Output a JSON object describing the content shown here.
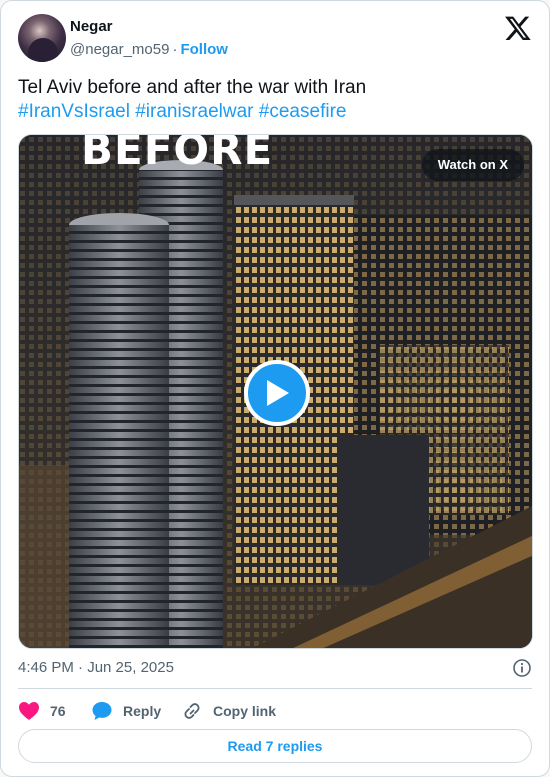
{
  "author": {
    "name": "Negar",
    "handle": "@negar_mo59",
    "separator": "·",
    "follow_label": "Follow"
  },
  "tweet": {
    "text": "Tel Aviv before and after the war with Iran",
    "hashtags": [
      "#IranVsIsrael",
      "#iranisraelwar",
      "#ceasefire"
    ]
  },
  "media": {
    "overlay_text": "BEFORE",
    "watch_label": "Watch on X",
    "play_icon": "play-icon"
  },
  "meta": {
    "timestamp": "4:46 PM · Jun 25, 2025",
    "info_icon": "info-icon"
  },
  "actions": {
    "likes_count": "76",
    "reply_label": "Reply",
    "copy_link_label": "Copy link"
  },
  "footer": {
    "read_replies_label": "Read 7 replies"
  },
  "colors": {
    "accent": "#1d9bf0",
    "like": "#f91880",
    "text_secondary": "#536471",
    "border": "#cfd9de"
  }
}
